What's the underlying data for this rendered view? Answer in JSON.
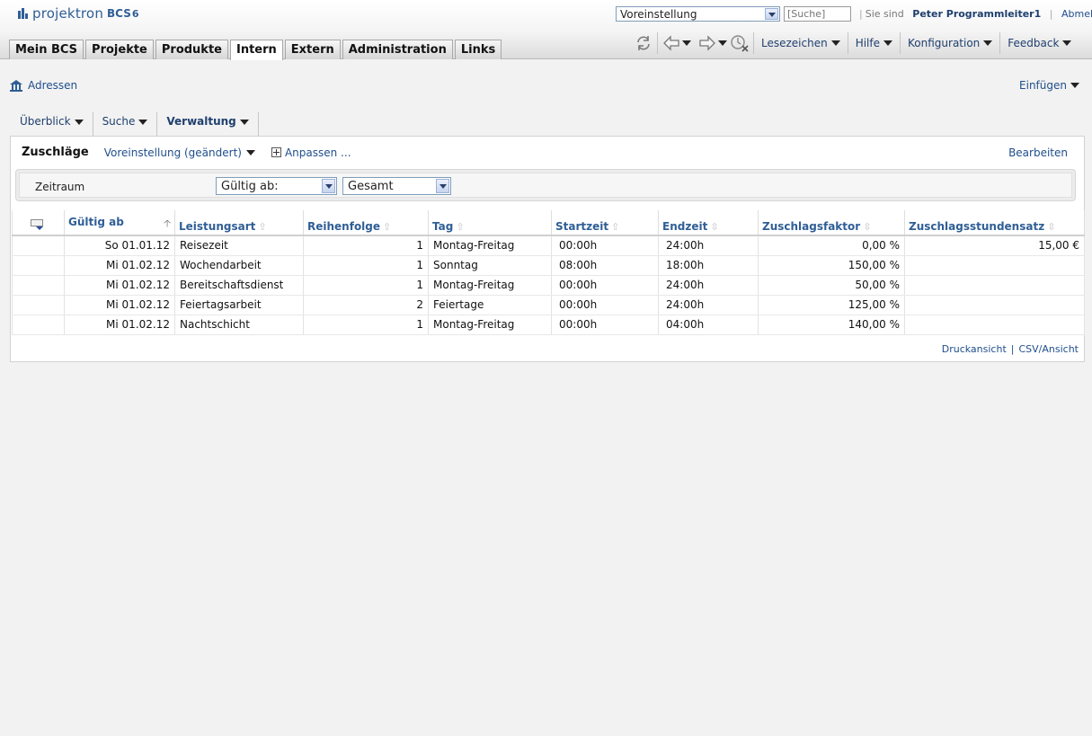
{
  "app": {
    "brand": "projektron",
    "suffix": "BCS",
    "version": "6",
    "colors": {
      "link": "#1f4e8c",
      "header_text": "#2f5e96",
      "tab_bg": "#d6d6d6"
    }
  },
  "header": {
    "preset_value": "Voreinstellung",
    "search_placeholder": "[Suche]",
    "you_are_label": "Sie sind",
    "user_name": "Peter Programmleiter1",
    "logout": "Abmelden",
    "separator": "|"
  },
  "main_tabs": [
    {
      "label": "Mein BCS",
      "active": false
    },
    {
      "label": "Projekte",
      "active": false
    },
    {
      "label": "Produkte",
      "active": false
    },
    {
      "label": "Intern",
      "active": true
    },
    {
      "label": "Extern",
      "active": false
    },
    {
      "label": "Administration",
      "active": false
    },
    {
      "label": "Links",
      "active": false
    }
  ],
  "toolbar": {
    "icons": [
      "refresh-icon",
      "back-icon",
      "forward-icon",
      "history-clear-icon"
    ],
    "menus": [
      {
        "label": "Lesezeichen"
      },
      {
        "label": "Hilfe"
      },
      {
        "label": "Konfiguration"
      },
      {
        "label": "Feedback"
      }
    ]
  },
  "page": {
    "breadcrumb": "Adressen",
    "insert_menu": "Einfügen",
    "sub_tabs": [
      {
        "label": "Überblick",
        "active": false
      },
      {
        "label": "Suche",
        "active": false
      },
      {
        "label": "Verwaltung",
        "active": true
      }
    ]
  },
  "panel": {
    "title": "Zuschläge",
    "preset": "Voreinstellung (geändert)",
    "customize": "Anpassen ...",
    "edit": "Bearbeiten",
    "filter": {
      "label": "Zeitraum",
      "mode_value": "Gültig ab:",
      "range_value": "Gesamt"
    },
    "table": {
      "columns": [
        {
          "label": "",
          "sort": "none"
        },
        {
          "label": "Gültig ab",
          "sort": "asc"
        },
        {
          "label": "Leistungsart",
          "sort": "inactive"
        },
        {
          "label": "Reihenfolge",
          "sort": "inactive"
        },
        {
          "label": "Tag",
          "sort": "inactive"
        },
        {
          "label": "Startzeit",
          "sort": "inactive"
        },
        {
          "label": "Endzeit",
          "sort": "inactive"
        },
        {
          "label": "Zuschlagsfaktor",
          "sort": "inactive"
        },
        {
          "label": "Zuschlagsstundensatz",
          "sort": "inactive"
        }
      ],
      "rows": [
        [
          "",
          "So 01.01.12",
          "Reisezeit",
          "1",
          "Montag-Freitag",
          "00:00h",
          "24:00h",
          "0,00 %",
          "15,00 €"
        ],
        [
          "",
          "Mi 01.02.12",
          "Wochendarbeit",
          "1",
          "Sonntag",
          "08:00h",
          "18:00h",
          "150,00 %",
          ""
        ],
        [
          "",
          "Mi 01.02.12",
          "Bereitschaftsdienst",
          "1",
          "Montag-Freitag",
          "00:00h",
          "24:00h",
          "50,00 %",
          ""
        ],
        [
          "",
          "Mi 01.02.12",
          "Feiertagsarbeit",
          "2",
          "Feiertage",
          "00:00h",
          "24:00h",
          "125,00 %",
          ""
        ],
        [
          "",
          "Mi 01.02.12",
          "Nachtschicht",
          "1",
          "Montag-Freitag",
          "00:00h",
          "04:00h",
          "140,00 %",
          ""
        ]
      ]
    },
    "footer": {
      "print": "Druckansicht",
      "csv": "CSV/Ansicht"
    }
  }
}
